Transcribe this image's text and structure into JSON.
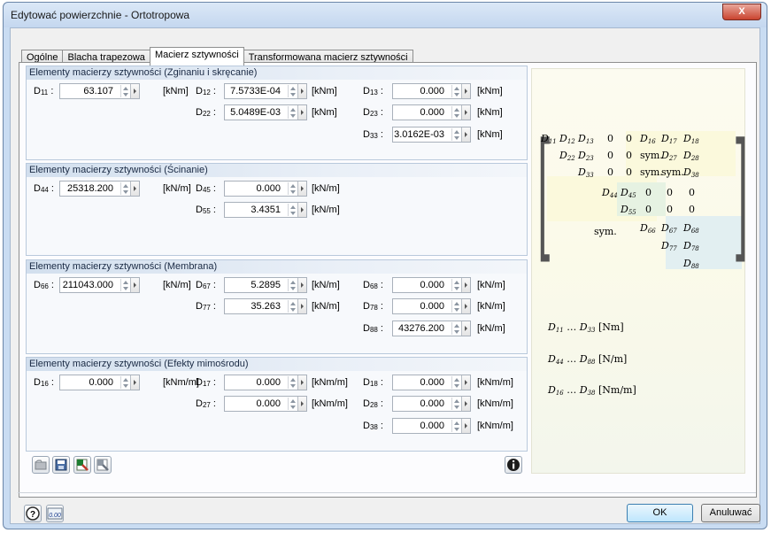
{
  "window": {
    "title": "Edytować powierzchnie - Ortotropowa",
    "close_label": "X"
  },
  "tabs": [
    "Ogólne",
    "Blacha trapezowa",
    "Macierz sztywności",
    "Transformowana macierz sztywności"
  ],
  "groups": {
    "bending": {
      "title": "Elementy macierzy sztywności (Zginaniu i skręcanie)",
      "fields": {
        "d11": {
          "label": "D11",
          "value": "63.107",
          "unit": "[kNm]"
        },
        "d12": {
          "label": "D12",
          "value": "7.5733E-04",
          "unit": "[kNm]"
        },
        "d13": {
          "label": "D13",
          "value": "0.000",
          "unit": "[kNm]"
        },
        "d22": {
          "label": "D22",
          "value": "5.0489E-03",
          "unit": "[kNm]"
        },
        "d23": {
          "label": "D23",
          "value": "0.000",
          "unit": "[kNm]"
        },
        "d33": {
          "label": "D33",
          "value": "3.0162E-03",
          "unit": "[kNm]"
        }
      }
    },
    "shear": {
      "title": "Elementy macierzy sztywności (Ścinanie)",
      "fields": {
        "d44": {
          "label": "D44",
          "value": "25318.200",
          "unit": "[kN/m]"
        },
        "d45": {
          "label": "D45",
          "value": "0.000",
          "unit": "[kN/m]"
        },
        "d55": {
          "label": "D55",
          "value": "3.4351",
          "unit": "[kN/m]"
        }
      }
    },
    "membrane": {
      "title": "Elementy macierzy sztywności (Membrana)",
      "fields": {
        "d66": {
          "label": "D66",
          "value": "211043.000",
          "unit": "[kN/m]"
        },
        "d67": {
          "label": "D67",
          "value": "5.2895",
          "unit": "[kN/m]"
        },
        "d68": {
          "label": "D68",
          "value": "0.000",
          "unit": "[kN/m]"
        },
        "d77": {
          "label": "D77",
          "value": "35.263",
          "unit": "[kN/m]"
        },
        "d78": {
          "label": "D78",
          "value": "0.000",
          "unit": "[kN/m]"
        },
        "d88": {
          "label": "D88",
          "value": "43276.200",
          "unit": "[kN/m]"
        }
      }
    },
    "eccentric": {
      "title": "Elementy macierzy sztywności (Efekty mimośrodu)",
      "fields": {
        "d16": {
          "label": "D16",
          "value": "0.000",
          "unit": "[kNm/m]"
        },
        "d17": {
          "label": "D17",
          "value": "0.000",
          "unit": "[kNm/m]"
        },
        "d18": {
          "label": "D18",
          "value": "0.000",
          "unit": "[kNm/m]"
        },
        "d27": {
          "label": "D27",
          "value": "0.000",
          "unit": "[kNm/m]"
        },
        "d28": {
          "label": "D28",
          "value": "0.000",
          "unit": "[kNm/m]"
        },
        "d38": {
          "label": "D38",
          "value": "0.000",
          "unit": "[kNm/m]"
        }
      }
    }
  },
  "matrix": {
    "sym": "sym.",
    "zero": "0",
    "legend": [
      {
        "from": "D11",
        "to": "D33",
        "unit": "[Nm]"
      },
      {
        "from": "D44",
        "to": "D88",
        "unit": "[N/m]"
      },
      {
        "from": "D16",
        "to": "D38",
        "unit": "[Nm/m]"
      }
    ],
    "colors": {
      "bending": "#fbf9dc",
      "shear": "#e6f2e2",
      "membrane": "#e2eff1"
    }
  },
  "toolbar_icons": [
    "open-icon",
    "save-icon",
    "export-excel-icon",
    "import-icon"
  ],
  "bottom_icons": [
    "help-icon",
    "units-icon"
  ],
  "units_icon_text": "0.00",
  "buttons": {
    "ok": "OK",
    "cancel": "Anuluwać"
  }
}
